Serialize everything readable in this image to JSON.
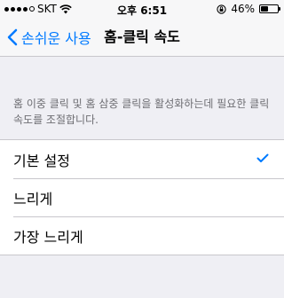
{
  "status_bar": {
    "carrier": "SKT",
    "time": "오후 6:51",
    "battery": "46%",
    "battery_level": 0.46,
    "signal_bars_filled": 4,
    "signal_bars_total": 5
  },
  "nav": {
    "back_label": "손쉬운 사용",
    "title": "홈-클릭 속도"
  },
  "description": "홈 이중 클릭 및 홈 삼중 클릭을 활성화하는데 필요한 클릭 속도를 조절합니다.",
  "options": [
    {
      "label": "기본 설정",
      "selected": true
    },
    {
      "label": "느리게",
      "selected": false
    },
    {
      "label": "가장 느리게",
      "selected": false
    }
  ],
  "colors": {
    "accent": "#007aff",
    "background": "#efeff4",
    "separator": "#c8c7cc",
    "secondary_text": "#6d6d72"
  },
  "icons": {
    "back": "chevron-left-icon",
    "selected": "checkmark-icon",
    "wifi": "wifi-icon",
    "rotation_lock": "rotation-lock-icon",
    "battery": "battery-icon"
  }
}
